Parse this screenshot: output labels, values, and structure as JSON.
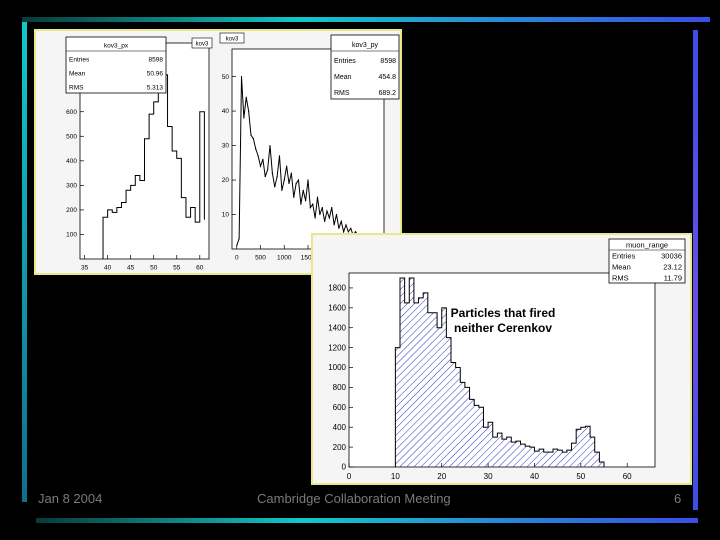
{
  "colors": {
    "background": "#000000",
    "frame_cyan": "#12c7c7",
    "frame_blue": "#3a4ee6",
    "panel_border": "#e8e88a",
    "histogram_line": "#000000",
    "hatch": "#3030c0"
  },
  "footer": {
    "date": "Jan 8 2004",
    "meeting": "Cambridge Collaboration Meeting",
    "page": "6"
  },
  "chart_data": [
    {
      "type": "bar",
      "pad_label": "kov3",
      "stats": {
        "title": "kov3_px",
        "rows": [
          [
            "Entries",
            "8598"
          ],
          [
            "Mean",
            "50.96"
          ],
          [
            "RMS",
            "5.313"
          ]
        ]
      },
      "xlim": [
        34,
        62
      ],
      "ylim": [
        0,
        880
      ],
      "xticks": [
        35,
        40,
        45,
        50,
        55,
        60
      ],
      "yticks": [
        100,
        200,
        300,
        400,
        500,
        600,
        700,
        800
      ],
      "bin_edges": [
        39,
        40,
        41,
        42,
        43,
        44,
        45,
        46,
        47,
        48,
        49,
        50,
        51,
        52,
        53,
        54,
        55,
        56,
        57,
        58,
        59,
        60,
        61
      ],
      "values": [
        170,
        200,
        190,
        210,
        230,
        280,
        300,
        340,
        320,
        490,
        590,
        640,
        840,
        750,
        540,
        440,
        410,
        250,
        170,
        210,
        150,
        600,
        160
      ]
    },
    {
      "type": "line",
      "pad_label": "kov3",
      "stats": {
        "title": "kov3_py",
        "rows": [
          [
            "Entries",
            "8598"
          ],
          [
            "Mean",
            "454.8"
          ],
          [
            "RMS",
            "689.2"
          ]
        ]
      },
      "xlim": [
        -100,
        3100
      ],
      "ylim": [
        0,
        58
      ],
      "xticks": [
        0,
        500,
        1000,
        1500,
        2000,
        2500,
        3000
      ],
      "yticks": [
        10,
        20,
        30,
        40,
        50
      ],
      "x": [
        0,
        50,
        100,
        150,
        200,
        250,
        300,
        350,
        400,
        450,
        500,
        550,
        600,
        650,
        700,
        750,
        800,
        850,
        900,
        950,
        1000,
        1050,
        1100,
        1150,
        1200,
        1250,
        1300,
        1350,
        1400,
        1450,
        1500,
        1550,
        1600,
        1650,
        1700,
        1750,
        1800,
        1850,
        1900,
        1950,
        2000,
        2050,
        2100,
        2150,
        2200,
        2250,
        2300,
        2350,
        2400,
        2450,
        2500,
        2550,
        2600,
        2650,
        2700,
        2750,
        2800,
        2850,
        2900,
        2950,
        3000
      ],
      "values": [
        1,
        3,
        50,
        38,
        44,
        40,
        33,
        32,
        29,
        27,
        24,
        26,
        21,
        23,
        30,
        22,
        18,
        21,
        27,
        17,
        20,
        24,
        19,
        22,
        15,
        19,
        20,
        13,
        17,
        14,
        20,
        12,
        13,
        9,
        15,
        10,
        12,
        8,
        11,
        9,
        12,
        7,
        10,
        6,
        8,
        5,
        7,
        5,
        6,
        4,
        5,
        4,
        3,
        3,
        2,
        2,
        1,
        2,
        1,
        1,
        0
      ]
    },
    {
      "type": "bar",
      "pad_label": "",
      "annotation": [
        "Particles that fired",
        "neither Cerenkov"
      ],
      "stats": {
        "title": "muon_range",
        "rows": [
          [
            "Entries",
            "30036"
          ],
          [
            "Mean",
            "23.12"
          ],
          [
            "RMS",
            "11.79"
          ]
        ]
      },
      "xlim": [
        0,
        66
      ],
      "ylim": [
        0,
        1950
      ],
      "xticks": [
        0,
        10,
        20,
        30,
        40,
        50,
        60
      ],
      "yticks": [
        0,
        200,
        400,
        600,
        800,
        1000,
        1200,
        1400,
        1600,
        1800
      ],
      "bin_edges": [
        10,
        11,
        12,
        13,
        14,
        15,
        16,
        17,
        18,
        19,
        20,
        21,
        22,
        23,
        24,
        25,
        26,
        27,
        28,
        29,
        30,
        31,
        32,
        33,
        34,
        35,
        36,
        37,
        38,
        39,
        40,
        41,
        42,
        43,
        44,
        45,
        46,
        47,
        48,
        49,
        50,
        51,
        52,
        53,
        54,
        55
      ],
      "values": [
        1200,
        1900,
        1650,
        1900,
        1650,
        1700,
        1750,
        1550,
        1550,
        1400,
        1600,
        1300,
        1050,
        1000,
        850,
        800,
        680,
        620,
        600,
        400,
        450,
        300,
        340,
        280,
        300,
        250,
        260,
        230,
        210,
        200,
        160,
        180,
        150,
        150,
        180,
        170,
        150,
        170,
        240,
        380,
        400,
        410,
        300,
        150,
        50
      ]
    }
  ]
}
